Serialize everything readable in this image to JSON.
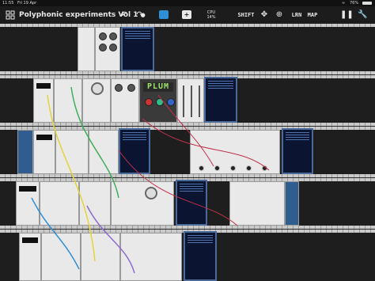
{
  "status": {
    "time": "11:55",
    "date": "Fri 19 Apr",
    "battery": "76%"
  },
  "toolbar": {
    "title": "Polyphonic experiments Vol 1",
    "cpu_label": "CPU",
    "cpu_value": "14%",
    "shift_label": "SHIFT",
    "lrn_label": "LRN",
    "map_label": "MAP"
  },
  "icons": [
    "grid-icon",
    "undo-icon",
    "redo-icon",
    "color-swatch-icon",
    "add-icon",
    "move-icon",
    "target-icon",
    "pause-icon",
    "wrench-icon",
    "wifi-icon",
    "battery-icon"
  ],
  "module_labels": {
    "plum": "PLUM"
  },
  "colors": {
    "accent": "#2f8fd6",
    "screen": "#0b1430",
    "cable_red": "#c0304a",
    "cable_yellow": "#e8d23a",
    "cable_green": "#3fae5a",
    "cable_purple": "#8e6bd1"
  }
}
